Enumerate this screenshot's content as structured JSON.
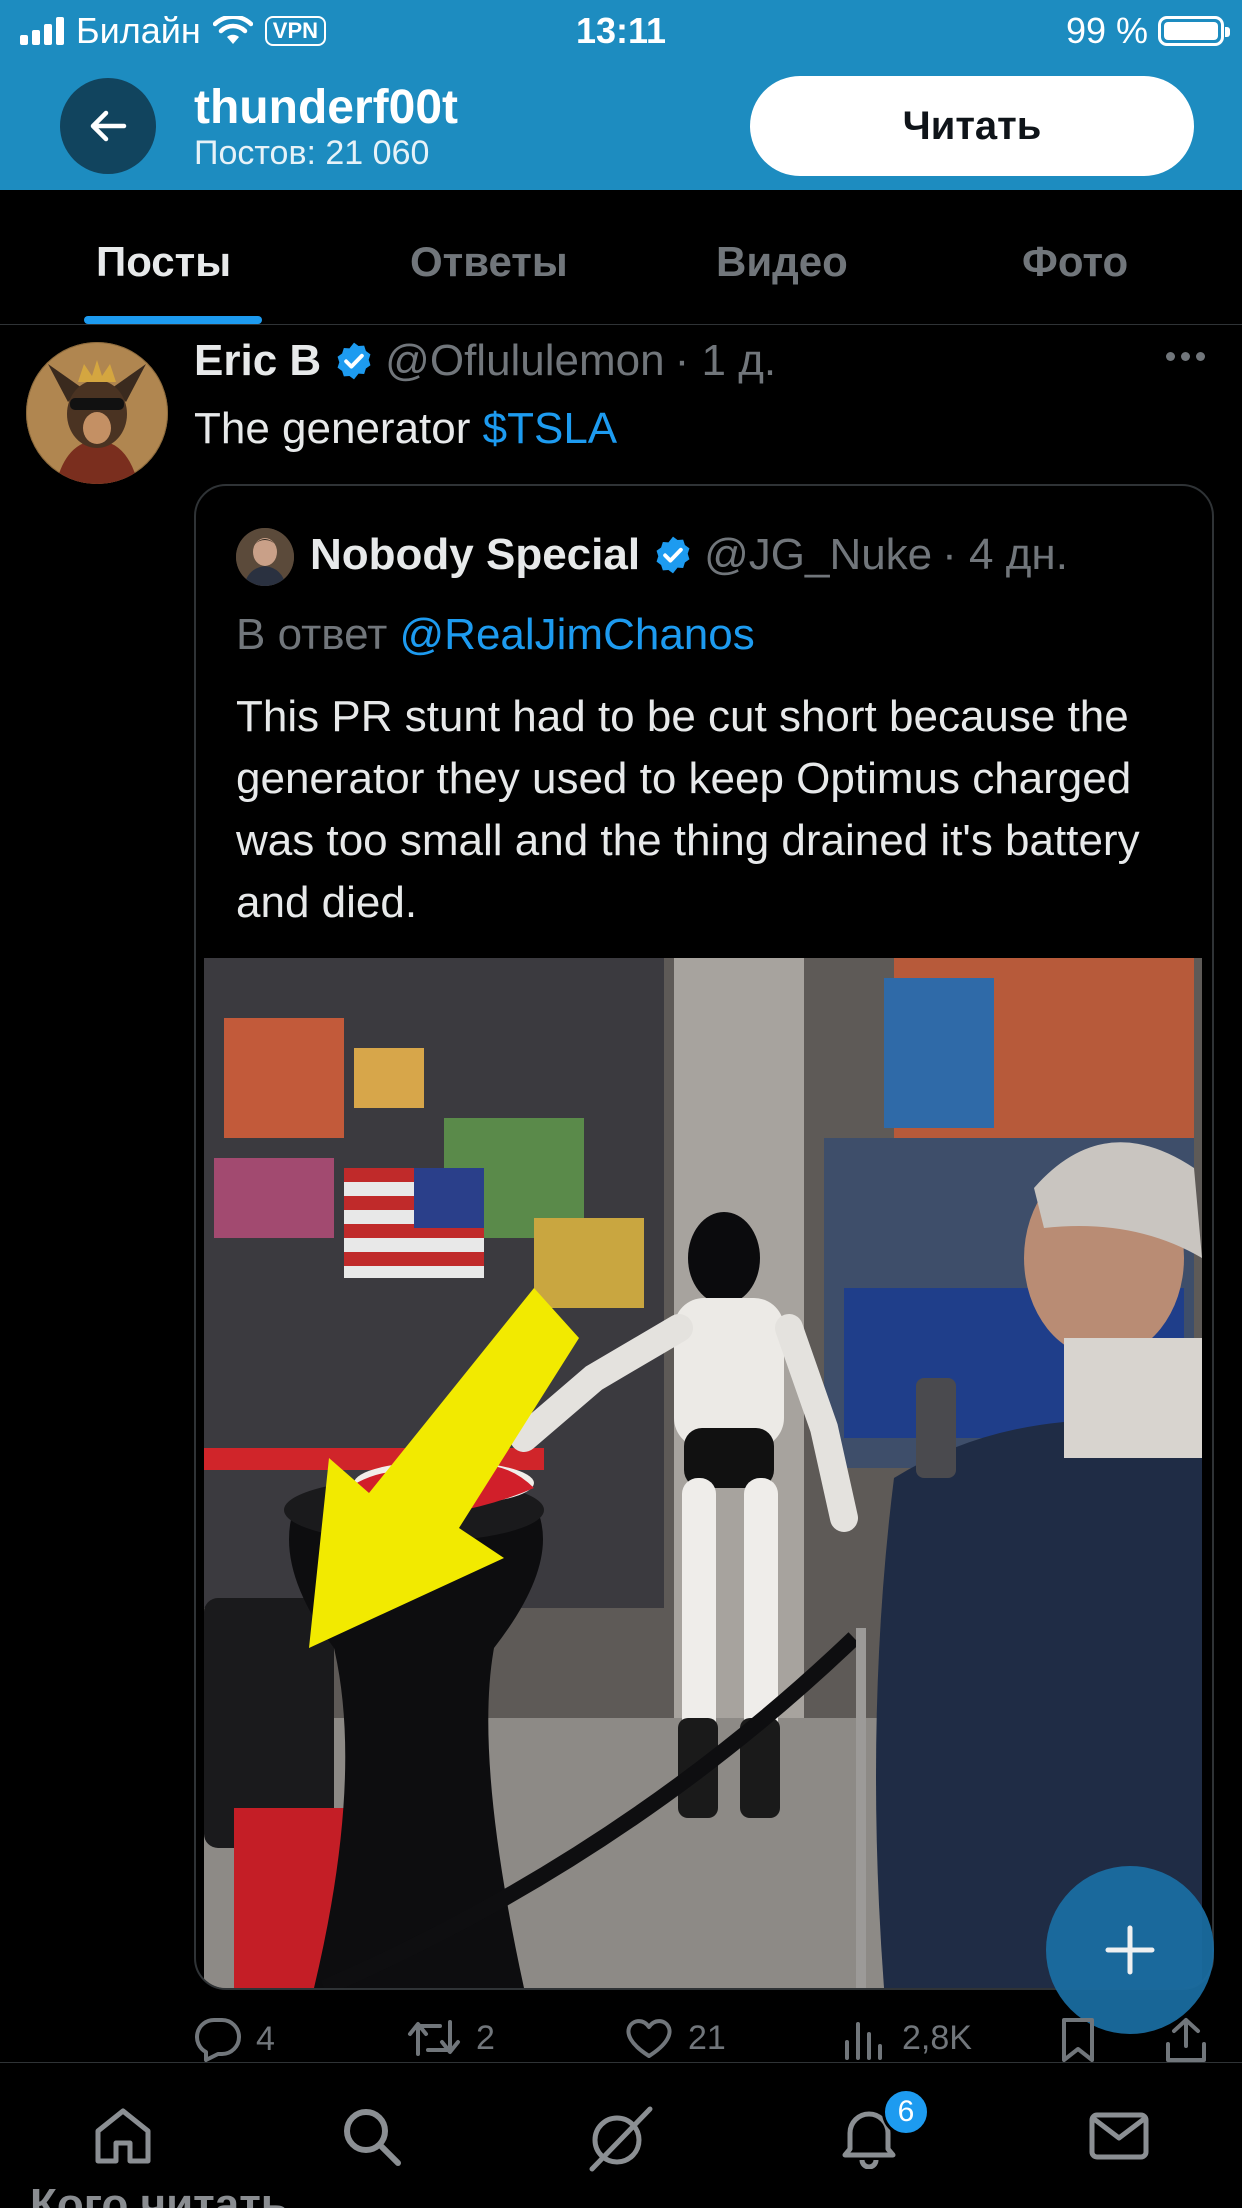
{
  "status_bar": {
    "carrier": "Билайн",
    "vpn": "VPN",
    "time": "13:11",
    "battery": "99 %"
  },
  "header": {
    "title": "thunderf00t",
    "subtitle": "Постов: 21 060",
    "follow_label": "Читать"
  },
  "tabs": [
    {
      "label": "Посты",
      "active": true
    },
    {
      "label": "Ответы",
      "active": false
    },
    {
      "label": "Видео",
      "active": false
    },
    {
      "label": "Фото",
      "active": false
    }
  ],
  "tweet": {
    "author_name": "Eric B",
    "handle": "@Oflululemon",
    "time": "· 1 д.",
    "text_prefix": "The generator ",
    "cashtag": "$TSLA",
    "quote": {
      "author_name": "Nobody Special",
      "handle": "@JG_Nuke",
      "time": "· 4 дн.",
      "reply_prefix": "В ответ ",
      "reply_mention": "@RealJimChanos",
      "text": "This PR stunt had to be cut short because the generator they used to keep Optimus charged was too small and the thing drained it's battery and died."
    },
    "stats": {
      "replies": "4",
      "retweets": "2",
      "likes": "21",
      "views": "2,8K"
    }
  },
  "bottom_nav": {
    "notifications_badge": "6",
    "peek_text": "Кого читать"
  },
  "colors": {
    "header_bg": "#1d8cc0",
    "accent": "#1d9bf0",
    "background": "#000000",
    "muted_text": "#71767b"
  }
}
